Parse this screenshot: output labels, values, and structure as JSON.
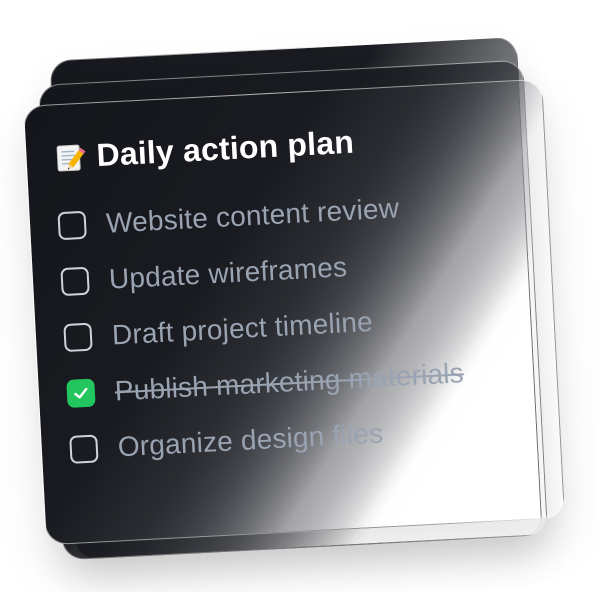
{
  "card": {
    "title": "Daily action plan",
    "title_icon": "memo-pencil-icon"
  },
  "tasks": [
    {
      "label": "Website content review",
      "checked": false
    },
    {
      "label": "Update wireframes",
      "checked": false
    },
    {
      "label": "Draft project timeline",
      "checked": false
    },
    {
      "label": "Publish marketing materials",
      "checked": true
    },
    {
      "label": "Organize design files",
      "checked": false
    }
  ],
  "colors": {
    "card_bg": "#16181d",
    "title": "#ffffff",
    "task_text": "#9aa3b2",
    "checkbox_border": "#cfd4dc",
    "checked": "#22c55e"
  }
}
